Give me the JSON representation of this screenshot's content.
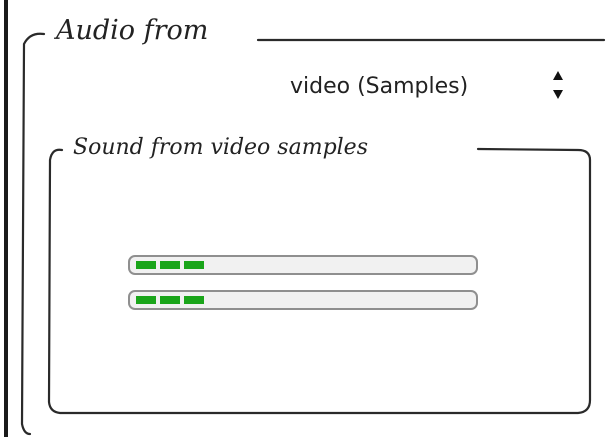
{
  "audio_from_group": {
    "title": "Audio from",
    "source_select": {
      "selected": "video (Samples)",
      "icon": "stepper-arrows-icon"
    }
  },
  "sound_group": {
    "title": "Sound from video samples",
    "meters": [
      {
        "channel": 1,
        "level": 0.24,
        "segments_lit": 3,
        "color": "#1aa51a"
      },
      {
        "channel": 2,
        "level": 0.24,
        "segments_lit": 3,
        "color": "#1aa51a"
      }
    ]
  },
  "colors": {
    "meter_fill": "#1aa51a",
    "border": "#2a2a2a"
  }
}
